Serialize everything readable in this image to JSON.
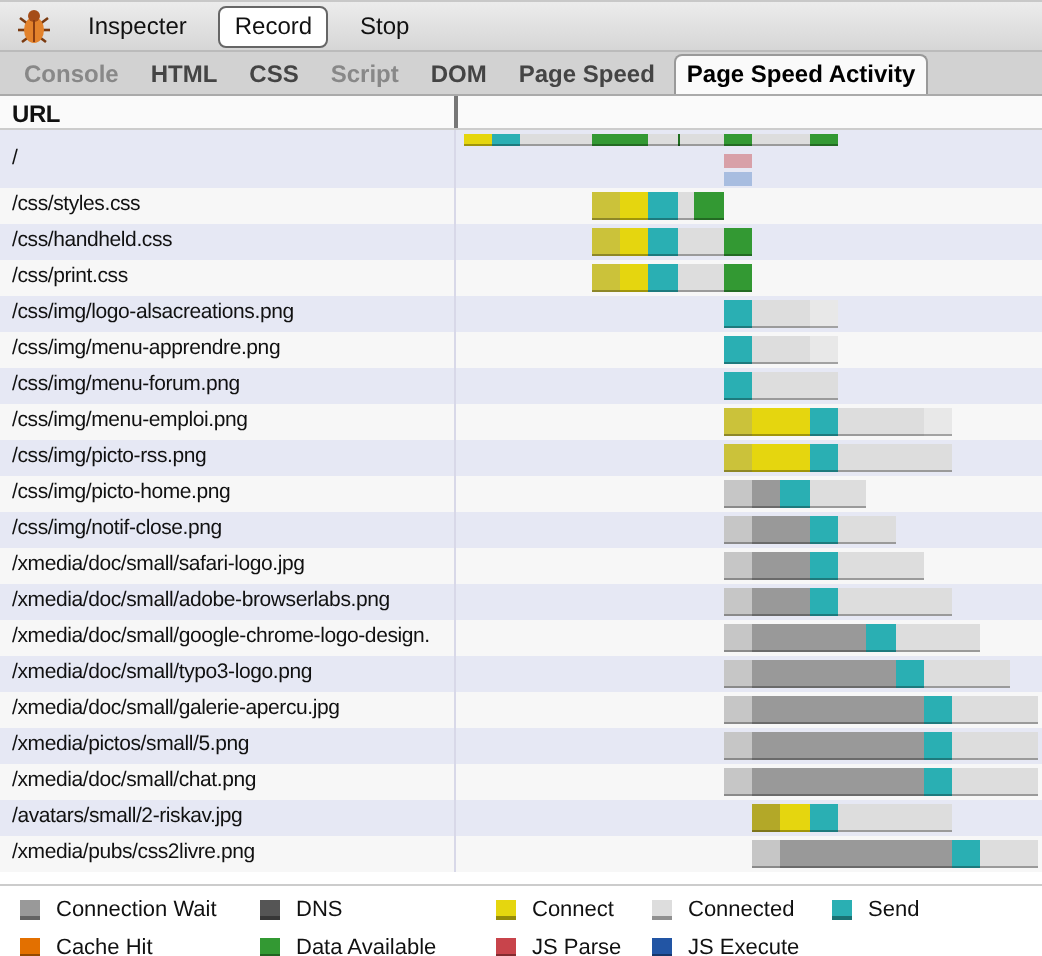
{
  "toolbar": {
    "buttons": [
      {
        "label": "Inspecter",
        "kind": "plain"
      },
      {
        "label": "Record",
        "kind": "outlined"
      },
      {
        "label": "Stop",
        "kind": "plain"
      }
    ]
  },
  "tabs": [
    {
      "label": "Console",
      "selected": false,
      "disabled": true
    },
    {
      "label": "HTML",
      "selected": false,
      "disabled": false
    },
    {
      "label": "CSS",
      "selected": false,
      "disabled": false
    },
    {
      "label": "Script",
      "selected": false,
      "disabled": true
    },
    {
      "label": "DOM",
      "selected": false,
      "disabled": false
    },
    {
      "label": "Page Speed",
      "selected": false,
      "disabled": false
    },
    {
      "label": "Page Speed Activity",
      "selected": true,
      "disabled": false
    }
  ],
  "table": {
    "columns": [
      "URL"
    ],
    "rows": [
      {
        "url": "/"
      },
      {
        "url": "/css/styles.css"
      },
      {
        "url": "/css/handheld.css"
      },
      {
        "url": "/css/print.css"
      },
      {
        "url": "/css/img/logo-alsacreations.png"
      },
      {
        "url": "/css/img/menu-apprendre.png"
      },
      {
        "url": "/css/img/menu-forum.png"
      },
      {
        "url": "/css/img/menu-emploi.png"
      },
      {
        "url": "/css/img/picto-rss.png"
      },
      {
        "url": "/css/img/picto-home.png"
      },
      {
        "url": "/css/img/notif-close.png"
      },
      {
        "url": "/xmedia/doc/small/safari-logo.jpg"
      },
      {
        "url": "/xmedia/doc/small/adobe-browserlabs.png"
      },
      {
        "url": "/xmedia/doc/small/google-chrome-logo-design."
      },
      {
        "url": "/xmedia/doc/small/typo3-logo.png"
      },
      {
        "url": "/xmedia/doc/small/galerie-apercu.jpg"
      },
      {
        "url": "/xmedia/pictos/small/5.png"
      },
      {
        "url": "/xmedia/doc/small/chat.png"
      },
      {
        "url": "/avatars/small/2-riskav.jpg"
      },
      {
        "url": "/xmedia/pubs/css2livre.png"
      }
    ]
  },
  "legend": [
    {
      "label": "Connection Wait",
      "color": "#999999"
    },
    {
      "label": "DNS",
      "color": "#555555"
    },
    {
      "label": "Connect",
      "color": "#e5d60f"
    },
    {
      "label": "Connected",
      "color": "#dddddd"
    },
    {
      "label": "Send",
      "color": "#2aafb3"
    },
    {
      "label": "Cache Hit",
      "color": "#e37000"
    },
    {
      "label": "Data Available",
      "color": "#339933"
    },
    {
      "label": "JS Parse",
      "color": "#c8444b"
    },
    {
      "label": "JS Execute",
      "color": "#2255a4"
    }
  ]
}
